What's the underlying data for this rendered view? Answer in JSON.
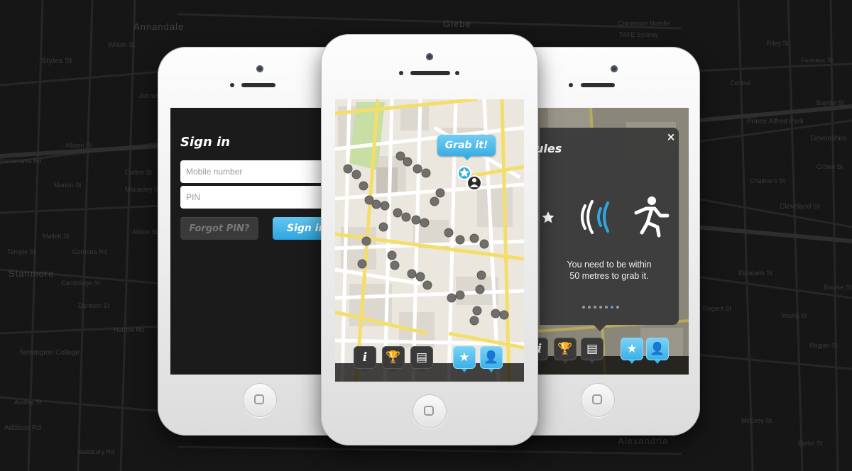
{
  "background_map": {
    "labels": [
      "Annandale",
      "Glebe",
      "Chinatown Noodle",
      "TAFE Sydney",
      "Styles St",
      "Central",
      "Foveaux St",
      "Prince Alfred Park",
      "Devonshire",
      "Cleveland St",
      "Stanmore",
      "Newington College",
      "Addison Rd",
      "Chalmers St",
      "Elizabeth St",
      "McEvoy St",
      "Alexandria",
      "Burke St",
      "Parramatta Rd",
      "Johnston St",
      "Albion St",
      "Mallett St",
      "Corunna Rd",
      "Denison St",
      "Audley St",
      "Salisbury Rd",
      "Cambridge St",
      "Harrow Rd",
      "Temple St",
      "Wilson St",
      "Raglan St",
      "Young St",
      "Bourke St",
      "Regent St",
      "Baptist St",
      "Riley St",
      "Crown St",
      "Marion St",
      "Allison St",
      "Macauley St",
      "Collins St"
    ]
  },
  "signin": {
    "title": "Sign in",
    "mobile_placeholder": "Mobile number",
    "pin_placeholder": "PIN",
    "forgot_label": "Forgot PIN?",
    "signin_label": "Sign in"
  },
  "map_screen": {
    "grab_label": "Grab it!",
    "toolbar": {
      "info_icon": "info-icon",
      "trophy_icon": "trophy-icon",
      "list_icon": "list-icon",
      "star_icon": "star-icon",
      "profile_icon": "profile-icon"
    }
  },
  "rules": {
    "title": "ules",
    "close_label": "×",
    "text_line1": "You need to be within",
    "text_line2": "50 metres to grab it.",
    "pages": 7,
    "current_page": 6
  },
  "colors": {
    "accent_blue": "#3aaee3",
    "dark_screen": "#1b1b1b",
    "map_road_yellow": "#f4de6a",
    "map_land": "#ece8df",
    "map_park": "#c7dfa5"
  }
}
